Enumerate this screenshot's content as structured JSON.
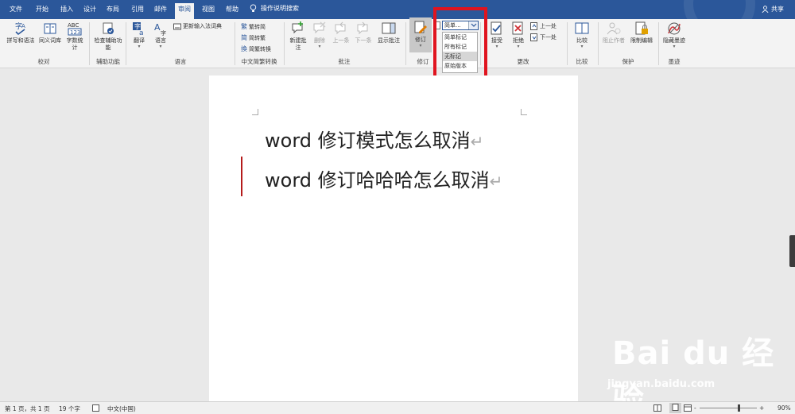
{
  "tabs": [
    "文件",
    "开始",
    "插入",
    "设计",
    "布局",
    "引用",
    "邮件",
    "审阅",
    "视图",
    "帮助"
  ],
  "active_tab": "审阅",
  "search": {
    "label": "操作说明搜索"
  },
  "share": {
    "label": "共享"
  },
  "ribbon": {
    "proofing": {
      "spelling": "拼写和语法",
      "thesaurus": "同义词库",
      "wordcount": "字数统计",
      "group": "校对"
    },
    "accessibility": {
      "check": "检查辅助功能",
      "group": "辅助功能"
    },
    "language": {
      "translate": "翻译",
      "language": "语言",
      "update_ime": "更新输入法词典",
      "group": "语言"
    },
    "chinese_conv": {
      "to_trad": "繁转简",
      "to_simp": "简转繁",
      "convert": "简繁转换",
      "group": "中文简繁转换"
    },
    "comments": {
      "new": "新建批注",
      "delete": "删除",
      "prev": "上一条",
      "next": "下一条",
      "show": "显示批注",
      "group": "批注"
    },
    "tracking": {
      "track": "修订",
      "group": "修订"
    },
    "markup_dropdown": {
      "current": "简单...",
      "options": [
        "简单标记",
        "所有标记",
        "无标记",
        "原始版本"
      ],
      "selected_index": 2
    },
    "changes": {
      "accept": "接受",
      "reject": "拒绝",
      "prev": "上一处",
      "next": "下一处",
      "group": "更改"
    },
    "compare": {
      "compare": "比较",
      "group": "比较"
    },
    "protect": {
      "block_authors": "阻止作者",
      "restrict": "限制编辑",
      "group": "保护"
    },
    "ink": {
      "hide_ink": "隐藏墨迹",
      "group": "墨迹"
    }
  },
  "document": {
    "lines": [
      "word 修订模式怎么取消",
      "word 修订哈哈哈怎么取消"
    ],
    "para_mark": "↵"
  },
  "status": {
    "page": "第 1 页，共 1 页",
    "words": "19 个字",
    "language": "中文(中国)",
    "zoom": "90%",
    "zoom_minus": "-",
    "zoom_plus": "+"
  },
  "watermark": {
    "main": "Bai du 经验",
    "sub": "jingyan.baidu.com"
  },
  "colors": {
    "title_bar": "#2b579a",
    "highlight_box": "#e0141f",
    "change_bar": "#b51b1b"
  }
}
